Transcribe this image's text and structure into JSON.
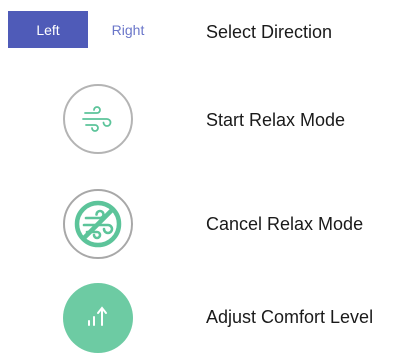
{
  "direction": {
    "left_label": "Left",
    "right_label": "Right",
    "selected": "Left",
    "description": "Select Direction"
  },
  "relax_start": {
    "icon": "wind-icon",
    "description": "Start Relax Mode"
  },
  "relax_cancel": {
    "icon": "wind-cancel-icon",
    "description": "Cancel Relax Mode"
  },
  "comfort": {
    "icon": "comfort-level-icon",
    "description": "Adjust Comfort Level"
  },
  "colors": {
    "selected_bg": "#4f5bb8",
    "unselected_text": "#6a76c9",
    "icon_green": "#6dcba3",
    "icon_stroke": "#5cc49a",
    "ring_gray": "#b4b4b4"
  }
}
